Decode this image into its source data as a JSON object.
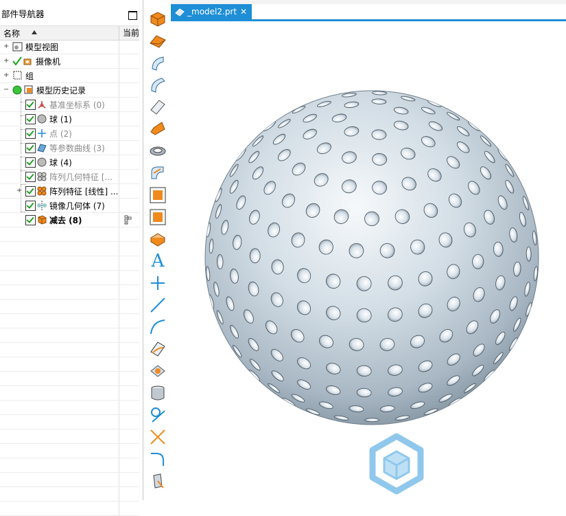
{
  "navigator": {
    "title": "部件导航器",
    "col_name": "名称",
    "col_current": "当前",
    "rows": [
      {
        "label": "模型视图",
        "style": "normal"
      },
      {
        "label": "摄像机",
        "style": "normal"
      },
      {
        "label": "组",
        "style": "normal"
      },
      {
        "label": "模型历史记录",
        "style": "normal"
      },
      {
        "label": "基准坐标系 (0)",
        "style": "grey"
      },
      {
        "label": "球 (1)",
        "style": "normal"
      },
      {
        "label": "点 (2)",
        "style": "grey"
      },
      {
        "label": "等参数曲线 (3)",
        "style": "grey"
      },
      {
        "label": "球 (4)",
        "style": "normal"
      },
      {
        "label": "阵列几何特征 [...",
        "style": "grey"
      },
      {
        "label": "阵列特征 [线性] ...",
        "style": "normal"
      },
      {
        "label": "镜像几何体 (7)",
        "style": "normal"
      },
      {
        "label": "减去 (8)",
        "style": "bold"
      }
    ]
  },
  "tab": {
    "label": "_model2.prt",
    "close": "✕"
  },
  "toolbar": {
    "text_tool_glyph": "A",
    "icons": [
      "block-icon",
      "wedge-icon",
      "surface-icon",
      "tube-surface-icon",
      "sheet-icon",
      "fold-icon",
      "elbow-icon",
      "bend-icon",
      "square-orange-icon",
      "square-orange-2-icon",
      "solid-box-icon",
      "text-icon",
      "point-plus-icon",
      "line-icon",
      "arc-icon",
      "patch-icon",
      "plane-icon",
      "cylinder-icon",
      "circle-line-icon",
      "cross-icon",
      "fillet-curve-icon",
      "extrude-icon"
    ]
  },
  "colors": {
    "accent": "#1e8ed6",
    "icon_orange": "#f08a1c",
    "sphere": "#c7d4de"
  }
}
